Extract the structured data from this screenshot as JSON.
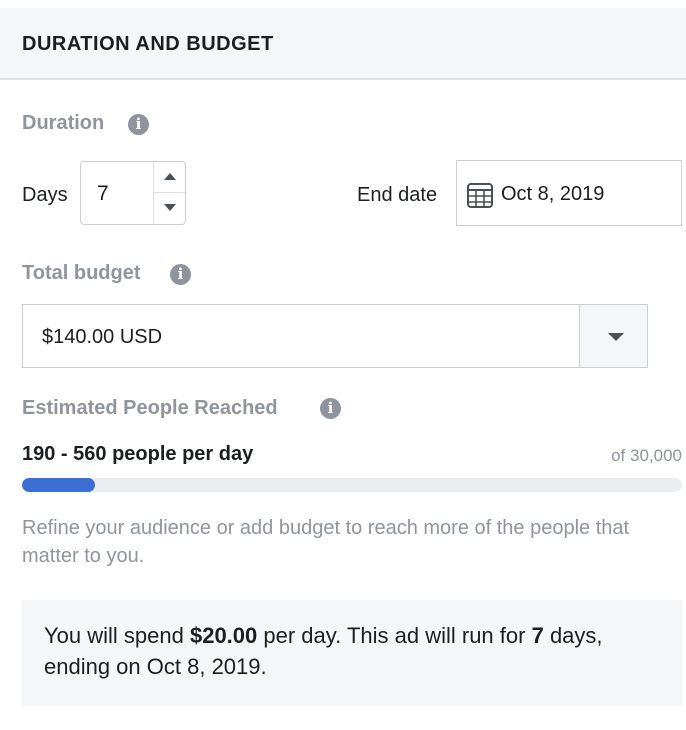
{
  "header": {
    "title": "DURATION AND BUDGET"
  },
  "duration": {
    "label": "Duration",
    "days_label": "Days",
    "days_value": "7",
    "end_date_label": "End date",
    "end_date_value": "Oct 8, 2019"
  },
  "budget": {
    "label": "Total budget",
    "value": "$140.00 USD"
  },
  "reach": {
    "label": "Estimated People Reached",
    "range": "190 - 560 people per day",
    "total": "of 30,000",
    "progress_fraction": 0.11
  },
  "hint": "Refine your audience or add budget to reach more of the people that matter to you.",
  "summary": {
    "part1": "You will spend ",
    "amount": "$20.00",
    "part2": " per day. This ad will run for ",
    "days": "7",
    "part3": " days, ending on ",
    "date": "Oct 8, 2019",
    "part4": "."
  },
  "colors": {
    "accent": "#3b6fd4",
    "muted_text": "#90949c",
    "panel_bg": "#f5f6f7"
  },
  "icons": {
    "info": "info-icon",
    "calendar": "calendar-icon",
    "stepper_up": "chevron-up-icon",
    "stepper_down": "chevron-down-icon",
    "dropdown": "caret-down-icon"
  }
}
